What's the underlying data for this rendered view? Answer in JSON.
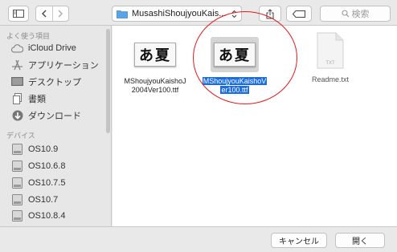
{
  "toolbar": {
    "path_label": "MusashiShoujyouKais...",
    "search_placeholder": "検索"
  },
  "sidebar": {
    "favorites_header": "よく使う項目",
    "favorites": [
      {
        "label": "iCloud Drive",
        "icon": "cloud-icon"
      },
      {
        "label": "アプリケーション",
        "icon": "applications-icon"
      },
      {
        "label": "デスクトップ",
        "icon": "desktop-icon"
      },
      {
        "label": "書類",
        "icon": "documents-icon"
      },
      {
        "label": "ダウンロード",
        "icon": "downloads-icon"
      }
    ],
    "devices_header": "デバイス",
    "devices": [
      {
        "label": "OS10.9",
        "icon": "disk-icon"
      },
      {
        "label": "OS10.6.8",
        "icon": "disk-icon"
      },
      {
        "label": "OS10.7.5",
        "icon": "disk-icon"
      },
      {
        "label": "OS10.7",
        "icon": "disk-icon"
      },
      {
        "label": "OS10.8.4",
        "icon": "disk-icon"
      }
    ]
  },
  "files": [
    {
      "name_line1": "MShoujyouKaishoJ",
      "name_line2": "2004Ver100.ttf",
      "preview": "あ夏",
      "selected": false
    },
    {
      "name_line1": "MShoujyouKaishoV",
      "name_line2": "er100.ttf",
      "preview": "あ夏",
      "selected": true
    },
    {
      "name_line1": "Readme.txt",
      "name_line2": "",
      "preview": "TXT",
      "selected": false
    }
  ],
  "buttons": {
    "cancel": "キャンセル",
    "open": "開く"
  },
  "colors": {
    "selection": "#1b6cde",
    "annotation": "#e01c1c"
  }
}
